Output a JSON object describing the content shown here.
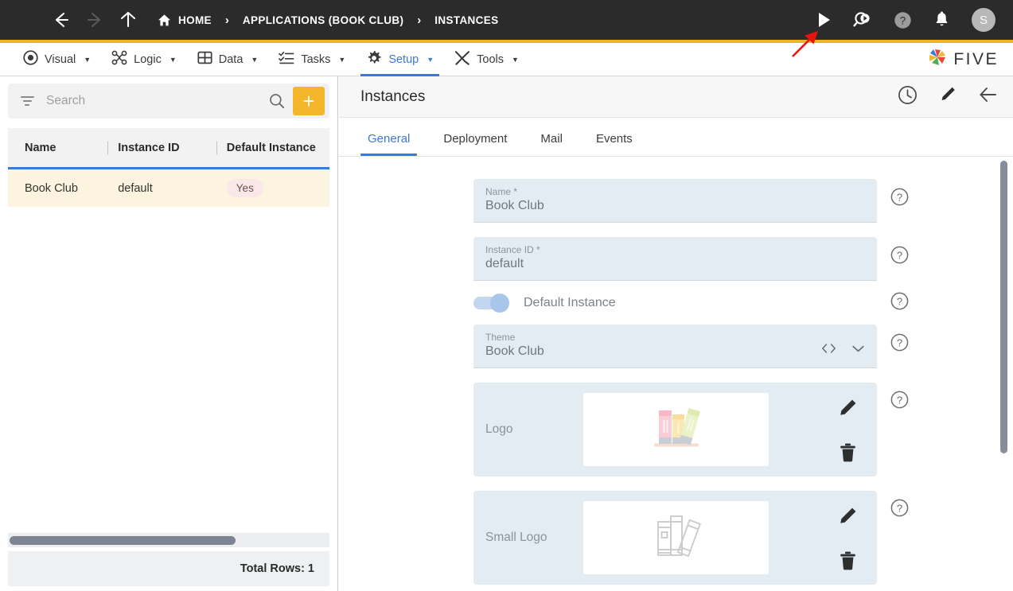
{
  "topbar": {
    "menu_icon": "hamburger-icon",
    "back_icon": "arrow-left-icon",
    "forward_icon": "arrow-right-icon",
    "up_icon": "arrow-up-icon",
    "breadcrumb": [
      {
        "label": "HOME",
        "icon": "home-icon"
      },
      {
        "label": "APPLICATIONS (BOOK CLUB)",
        "icon": ""
      },
      {
        "label": "INSTANCES",
        "icon": ""
      }
    ],
    "separator": "›",
    "right_icons": [
      {
        "name": "run-play-icon"
      },
      {
        "name": "search-run-icon"
      },
      {
        "name": "help-circle-icon"
      },
      {
        "name": "notifications-bell-icon"
      }
    ],
    "avatar_initial": "S",
    "accent_color": "#f0b323",
    "background_color": "#2b2b2b"
  },
  "menubar": {
    "items": [
      {
        "label": "Visual",
        "icon": "eye-icon",
        "caret": "▼",
        "active": false
      },
      {
        "label": "Logic",
        "icon": "logic-icon",
        "caret": "▼",
        "active": false
      },
      {
        "label": "Data",
        "icon": "table-icon",
        "caret": "▼",
        "active": false
      },
      {
        "label": "Tasks",
        "icon": "tasks-icon",
        "caret": "▼",
        "active": false
      },
      {
        "label": "Setup",
        "icon": "gear-icon",
        "caret": "▼",
        "active": true
      },
      {
        "label": "Tools",
        "icon": "tools-icon",
        "caret": "▼",
        "active": false
      }
    ],
    "brand": "FIVE",
    "active_color": "#3b78d8"
  },
  "sidebar": {
    "search": {
      "value": "",
      "placeholder": "Search"
    },
    "filter_icon": "filter-icon",
    "search_icon": "search-icon",
    "add_label": "+",
    "add_color": "#f5b62c",
    "grid": {
      "columns": [
        "Name",
        "Instance ID",
        "Default Instance"
      ],
      "rows": [
        {
          "name": "Book Club",
          "instance_id": "default",
          "default_instance": "Yes"
        }
      ]
    },
    "footer": "Total Rows: 1"
  },
  "main": {
    "title": "Instances",
    "header_icons": [
      {
        "name": "history-clock-icon"
      },
      {
        "name": "edit-pencil-icon"
      },
      {
        "name": "back-arrow-icon"
      }
    ],
    "tabs": [
      {
        "label": "General",
        "active": true
      },
      {
        "label": "Deployment",
        "active": false
      },
      {
        "label": "Mail",
        "active": false
      },
      {
        "label": "Events",
        "active": false
      }
    ],
    "form": {
      "name": {
        "label": "Name *",
        "value": "Book Club"
      },
      "instance_id": {
        "label": "Instance ID *",
        "value": "default"
      },
      "default_instance": {
        "label": "Default Instance",
        "value": "on"
      },
      "theme": {
        "label": "Theme",
        "value": "Book Club",
        "icons": [
          "code-brackets-icon",
          "chevron-down-icon"
        ]
      },
      "logo": {
        "label": "Logo",
        "image": "book-stack-color-image"
      },
      "small_logo": {
        "label": "Small Logo",
        "image": "book-stack-outline-image"
      }
    },
    "help_icon": "help-circle-icon",
    "edit_icon": "edit-pencil-icon",
    "delete_icon": "trash-icon"
  },
  "annotation": {
    "arrow_color": "#e8140f",
    "points_to": "run-play-icon"
  }
}
